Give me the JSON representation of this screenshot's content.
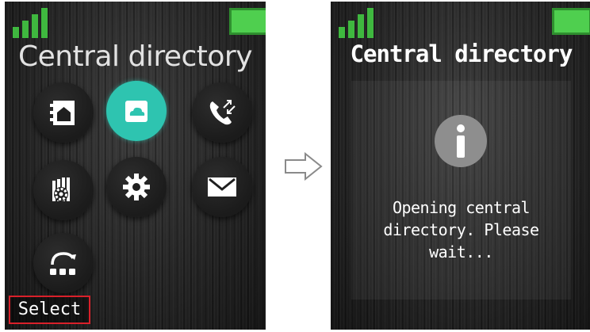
{
  "left_screen": {
    "title": "Central directory",
    "menu_items": [
      {
        "icon": "local-phonebook-icon",
        "selected": false
      },
      {
        "icon": "central-directory-icon",
        "selected": true
      },
      {
        "icon": "call-list-icon",
        "selected": false
      },
      {
        "icon": "settings-phone-icon",
        "selected": false
      },
      {
        "icon": "gear-icon",
        "selected": false
      },
      {
        "icon": "envelope-icon",
        "selected": false
      },
      {
        "icon": "headset-connection-icon",
        "selected": false
      }
    ],
    "softkey_label": "Select"
  },
  "right_screen": {
    "title": "Central directory",
    "dialog_message": "Opening central\ndirectory. Please\nwait..."
  },
  "colors": {
    "accent_teal": "#2ec4b0",
    "signal_green": "#3fb83f",
    "softkey_highlight": "#d9202a"
  }
}
